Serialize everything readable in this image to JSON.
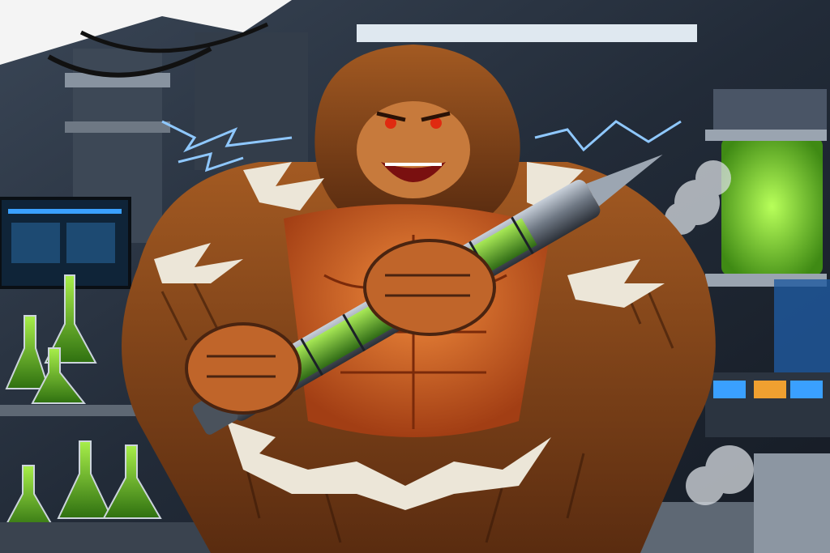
{
  "image": {
    "subject": "bigfoot",
    "held_object": "syringe",
    "setting": "laboratory",
    "palette": {
      "fur": "#8a4a1c",
      "fur_dark": "#4a2410",
      "muscle": "#d8652a",
      "eyes": "#e02a10",
      "liquid": "#6fd12a",
      "electric": "#6fb8ff",
      "steel": "#7d8794",
      "lab_bg": "#2a3444",
      "white_fur": "#ece6d8"
    },
    "icons": [
      "flask-icon",
      "lightning-icon",
      "monitor-icon",
      "tank-icon",
      "steam-icon"
    ]
  }
}
